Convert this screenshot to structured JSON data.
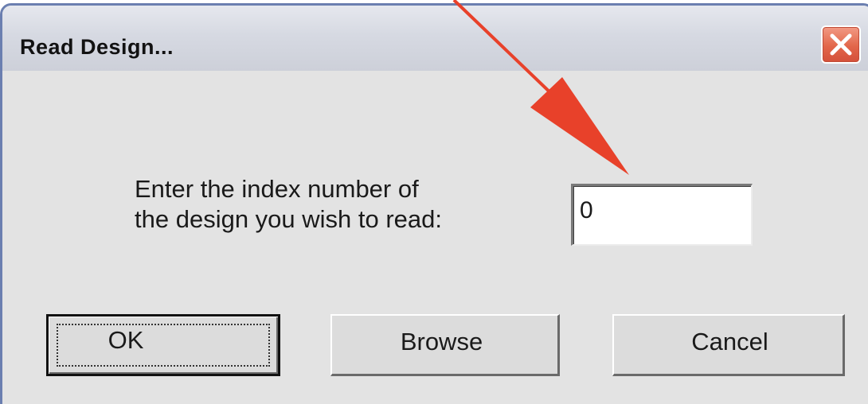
{
  "window": {
    "title": "Read Design..."
  },
  "dialog": {
    "prompt_line1": "Enter the index number of",
    "prompt_line2": "the design you wish to read:",
    "index_value": "0"
  },
  "buttons": {
    "ok_label": "OK",
    "browse_label": "Browse",
    "cancel_label": "Cancel"
  },
  "icons": {
    "close": "close-x-icon",
    "annotation": "red-arrow-annotation"
  },
  "colors": {
    "annotation_arrow": "#e8412a",
    "close_button": "#e2664a"
  }
}
